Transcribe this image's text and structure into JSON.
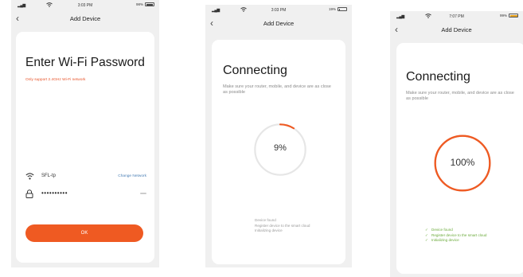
{
  "screens": [
    {
      "status": {
        "time": "3:03 PM",
        "battery": "98%"
      },
      "header": {
        "back_icon": "chevron-left-icon",
        "title": "Add Device"
      },
      "title": "Enter Wi-Fi Password",
      "warning": "Only support 2.4GHz Wi-Fi network",
      "wifi": {
        "icon": "wifi-icon",
        "ssid": "SFL-tp",
        "change_label": "Change Network"
      },
      "password": {
        "icon": "lock-icon",
        "masked": "••••••••••"
      },
      "ok_label": "OK",
      "accent": "#ef5a22"
    },
    {
      "status": {
        "time": "3:03 PM",
        "battery": "19%"
      },
      "header": {
        "back_icon": "chevron-left-icon",
        "title": "Add Device"
      },
      "title": "Connecting",
      "description": "Make sure your router, mobile, and device are as close as possible",
      "progress": {
        "percent": 9,
        "label": "9%"
      },
      "steps": [
        {
          "mark": "",
          "text": "Device found"
        },
        {
          "mark": "",
          "text": "Register device to the smart cloud"
        },
        {
          "mark": "",
          "text": "Initializing device"
        }
      ]
    },
    {
      "status": {
        "time": "7:07 PM",
        "battery": "99%"
      },
      "header": {
        "back_icon": "chevron-left-icon",
        "title": "Add Device"
      },
      "title": "Connecting",
      "description": "Make sure your router, mobile, and device are as close as possible",
      "progress": {
        "percent": 100,
        "label": "100%"
      },
      "steps": [
        {
          "mark": "✓",
          "text": "Device found"
        },
        {
          "mark": "✓",
          "text": "Register device to the smart cloud"
        },
        {
          "mark": "✓",
          "text": "Initializing device"
        }
      ]
    }
  ]
}
